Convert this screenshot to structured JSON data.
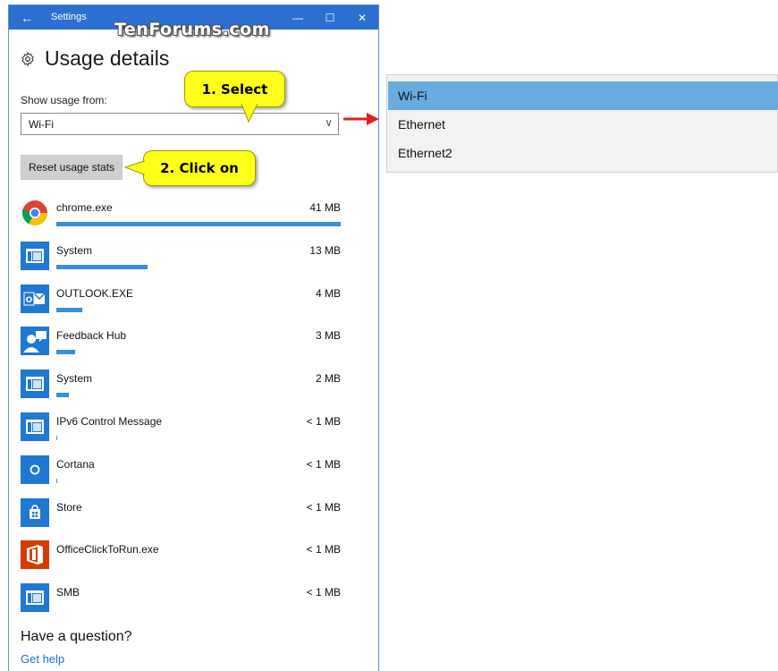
{
  "window": {
    "title": "Settings",
    "back_glyph": "←",
    "minimize_glyph": "—",
    "maximize_glyph": "☐",
    "close_glyph": "✕"
  },
  "watermark": "TenForums.com",
  "page": {
    "title": "Usage details",
    "icon": "gear-icon"
  },
  "usage_source": {
    "label": "Show usage from:",
    "selected": "Wi-Fi",
    "chevron": "∨"
  },
  "reset_button": {
    "label": "Reset usage stats"
  },
  "callouts": {
    "select": "1. Select",
    "click_on": "2. Click on"
  },
  "apps": [
    {
      "name": "chrome.exe",
      "size": "41 MB",
      "usage_fraction": 1.0,
      "icon": "chrome-icon"
    },
    {
      "name": "System",
      "size": "13 MB",
      "usage_fraction": 0.32,
      "icon": "system-window-icon"
    },
    {
      "name": "OUTLOOK.EXE",
      "size": "4 MB",
      "usage_fraction": 0.09,
      "icon": "outlook-icon"
    },
    {
      "name": "Feedback Hub",
      "size": "3 MB",
      "usage_fraction": 0.065,
      "icon": "feedback-hub-icon"
    },
    {
      "name": "System",
      "size": "2 MB",
      "usage_fraction": 0.045,
      "icon": "system-window-icon"
    },
    {
      "name": "IPv6 Control Message",
      "size": "< 1 MB",
      "usage_fraction": 0.004,
      "icon": "system-window-icon"
    },
    {
      "name": "Cortana",
      "size": "< 1 MB",
      "usage_fraction": 0.004,
      "icon": "cortana-icon"
    },
    {
      "name": "Store",
      "size": "< 1 MB",
      "usage_fraction": 0.0,
      "icon": "store-icon"
    },
    {
      "name": "OfficeClickToRun.exe",
      "size": "< 1 MB",
      "usage_fraction": 0.0,
      "icon": "office-icon"
    },
    {
      "name": "SMB",
      "size": "< 1 MB",
      "usage_fraction": 0.0,
      "icon": "system-window-icon"
    }
  ],
  "help": {
    "question": "Have a question?",
    "link": "Get help"
  },
  "dropdown_options": [
    "Wi-Fi",
    "Ethernet",
    "Ethernet2"
  ],
  "dropdown_selected_index": 0,
  "colors": {
    "titlebar": "#2b6fd0",
    "accent": "#3b8fd6",
    "callout": "#ffff1a",
    "arrow": "#e02020",
    "selected_option": "#6aabdf"
  }
}
